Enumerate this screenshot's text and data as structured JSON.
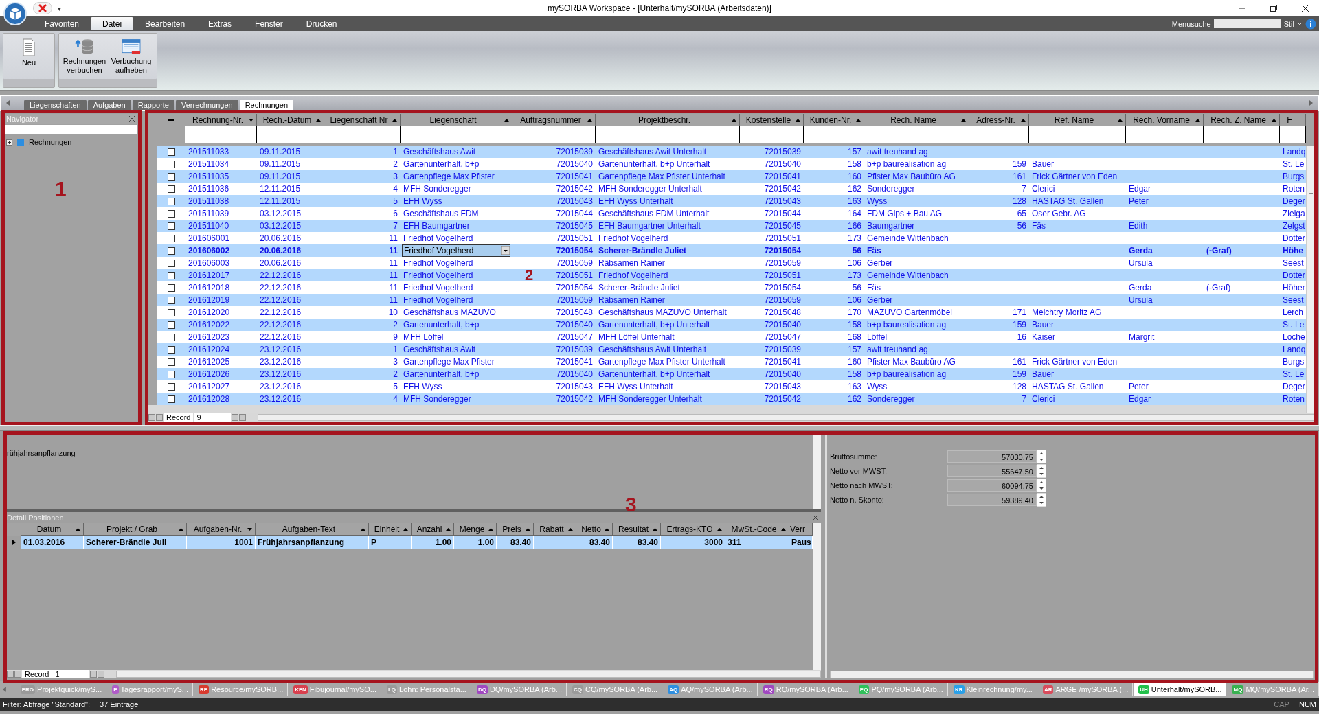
{
  "window": {
    "title": "mySORBA Workspace - [Unterhalt/mySORBA (Arbeitsdaten)]",
    "quick_access": "▾"
  },
  "menu_tabs": [
    {
      "label": "Favoriten",
      "selected": false
    },
    {
      "label": "Datei",
      "selected": true
    },
    {
      "label": "Bearbeiten",
      "selected": false
    },
    {
      "label": "Extras",
      "selected": false
    },
    {
      "label": "Fenster",
      "selected": false
    },
    {
      "label": "Drucken",
      "selected": false
    }
  ],
  "menu_search": {
    "label": "Menusuche",
    "style_label": "Stil"
  },
  "ribbon": [
    {
      "kind": "new",
      "label": "Neu"
    },
    {
      "kind": "post",
      "label": "Rechnungen verbuchen"
    },
    {
      "kind": "unpost",
      "label": "Verbuchung aufheben"
    }
  ],
  "doc_tabs": [
    {
      "label": "Liegenschaften",
      "selected": false
    },
    {
      "label": "Aufgaben",
      "selected": false
    },
    {
      "label": "Rapporte",
      "selected": false
    },
    {
      "label": "Verrechnungen",
      "selected": false
    },
    {
      "label": "Rechnungen",
      "selected": true
    }
  ],
  "navigator": {
    "title": "Navigator",
    "items": [
      {
        "label": "Rechnungen",
        "expanded": false
      }
    ]
  },
  "table": {
    "columns": [
      {
        "label": "Rechnung-Nr.",
        "descending": true
      },
      {
        "label": "Rech.-Datum",
        "descending": false
      },
      {
        "label": "Liegenschaft Nr",
        "descending": false
      },
      {
        "label": "Liegenschaft",
        "descending": false
      },
      {
        "label": "Auftragsnummer",
        "descending": false
      },
      {
        "label": "Projektbeschr.",
        "descending": false
      },
      {
        "label": "Kostenstelle",
        "descending": false
      },
      {
        "label": "Kunden-Nr.",
        "descending": false
      },
      {
        "label": "Rech. Name",
        "descending": false
      },
      {
        "label": "Adress-Nr.",
        "descending": false
      },
      {
        "label": "Ref. Name",
        "descending": false
      },
      {
        "label": "Rech. Vorname",
        "descending": false
      },
      {
        "label": "Rech. Z. Name",
        "descending": false
      },
      {
        "label": "F"
      }
    ],
    "rows": [
      {
        "selected": false,
        "checked": false,
        "cells": [
          "201511033",
          "09.11.2015",
          "1",
          "Geschäftshaus Awit",
          "72015039",
          "Geschäftshaus Awit Unterhalt",
          "72015039",
          "157",
          "awit treuhand ag",
          "",
          "",
          "",
          "",
          "Landq"
        ]
      },
      {
        "selected": false,
        "checked": false,
        "cells": [
          "201511034",
          "09.11.2015",
          "2",
          "Gartenunterhalt, b+p",
          "72015040",
          "Gartenunterhalt, b+p Unterhalt",
          "72015040",
          "158",
          "b+p baurealisation ag",
          "159",
          "Bauer",
          "",
          "",
          "St. Le"
        ]
      },
      {
        "selected": false,
        "checked": false,
        "cells": [
          "201511035",
          "09.11.2015",
          "3",
          "Gartenpflege Max Pfister",
          "72015041",
          "Gartenpflege Max Pfister Unterhalt",
          "72015041",
          "160",
          "Pfister Max Baubüro AG",
          "161",
          "Frick Gärtner von Eden",
          "",
          "",
          "Burgs"
        ]
      },
      {
        "selected": false,
        "checked": false,
        "cells": [
          "201511036",
          "12.11.2015",
          "4",
          "MFH Sonderegger",
          "72015042",
          "MFH Sonderegger Unterhalt",
          "72015042",
          "162",
          "Sonderegger",
          "7",
          "Clerici",
          "Edgar",
          "",
          "Roten"
        ]
      },
      {
        "selected": false,
        "checked": false,
        "cells": [
          "201511038",
          "12.11.2015",
          "5",
          "EFH Wyss",
          "72015043",
          "EFH Wyss Unterhalt",
          "72015043",
          "163",
          "Wyss",
          "128",
          "HASTAG St. Gallen",
          "Peter",
          "",
          "Deger"
        ]
      },
      {
        "selected": false,
        "checked": false,
        "cells": [
          "201511039",
          "03.12.2015",
          "6",
          "Geschäftshaus FDM",
          "72015044",
          "Geschäftshaus FDM Unterhalt",
          "72015044",
          "164",
          "FDM Gips + Bau AG",
          "65",
          "Oser Gebr. AG",
          "",
          "",
          "Zielga"
        ]
      },
      {
        "selected": false,
        "checked": false,
        "cells": [
          "201511040",
          "03.12.2015",
          "7",
          "EFH Baumgartner",
          "72015045",
          "EFH Baumgartner Unterhalt",
          "72015045",
          "166",
          "Baumgartner",
          "56",
          "Fäs",
          "Edith",
          "",
          "Zelgst"
        ]
      },
      {
        "selected": false,
        "checked": false,
        "cells": [
          "201606001",
          "20.06.2016",
          "11",
          "Friedhof Vogelherd",
          "72015051",
          "Friedhof Vogelherd",
          "72015051",
          "173",
          "Gemeinde Wittenbach",
          "",
          "",
          "",
          "",
          "Dotter"
        ]
      },
      {
        "selected": true,
        "checked": false,
        "cells": [
          "201606002",
          "20.06.2016",
          "11",
          "Friedhof Vogelherd",
          "72015054",
          "Scherer-Brändle Juliet",
          "72015054",
          "56",
          "Fäs",
          "",
          "",
          "Gerda",
          "(-Graf)",
          "Höhe"
        ]
      },
      {
        "selected": false,
        "checked": false,
        "cells": [
          "201606003",
          "20.06.2016",
          "11",
          "Friedhof Vogelherd",
          "72015059",
          "Räbsamen Rainer",
          "72015059",
          "106",
          "Gerber",
          "",
          "",
          "Ursula",
          "",
          "Seest"
        ]
      },
      {
        "selected": false,
        "checked": false,
        "cells": [
          "201612017",
          "22.12.2016",
          "11",
          "Friedhof Vogelherd",
          "72015051",
          "Friedhof Vogelherd",
          "72015051",
          "173",
          "Gemeinde Wittenbach",
          "",
          "",
          "",
          "",
          "Dotter"
        ]
      },
      {
        "selected": false,
        "checked": false,
        "cells": [
          "201612018",
          "22.12.2016",
          "11",
          "Friedhof Vogelherd",
          "72015054",
          "Scherer-Brändle Juliet",
          "72015054",
          "56",
          "Fäs",
          "",
          "",
          "Gerda",
          "(-Graf)",
          "Höher"
        ]
      },
      {
        "selected": false,
        "checked": false,
        "cells": [
          "201612019",
          "22.12.2016",
          "11",
          "Friedhof Vogelherd",
          "72015059",
          "Räbsamen Rainer",
          "72015059",
          "106",
          "Gerber",
          "",
          "",
          "Ursula",
          "",
          "Seest"
        ]
      },
      {
        "selected": false,
        "checked": false,
        "cells": [
          "201612020",
          "22.12.2016",
          "10",
          "Geschäftshaus MAZUVO",
          "72015048",
          "Geschäftshaus MAZUVO Unterhalt",
          "72015048",
          "170",
          "MAZUVO Gartenmöbel",
          "171",
          "Meichtry Moritz AG",
          "",
          "",
          "Lerch"
        ]
      },
      {
        "selected": false,
        "checked": false,
        "cells": [
          "201612022",
          "22.12.2016",
          "2",
          "Gartenunterhalt, b+p",
          "72015040",
          "Gartenunterhalt, b+p Unterhalt",
          "72015040",
          "158",
          "b+p baurealisation ag",
          "159",
          "Bauer",
          "",
          "",
          "St. Le"
        ]
      },
      {
        "selected": false,
        "checked": false,
        "cells": [
          "201612023",
          "22.12.2016",
          "9",
          "MFH Löffel",
          "72015047",
          "MFH Löffel Unterhalt",
          "72015047",
          "168",
          "Löffel",
          "16",
          "Kaiser",
          "Margrit",
          "",
          "Loche"
        ]
      },
      {
        "selected": false,
        "checked": false,
        "cells": [
          "201612024",
          "23.12.2016",
          "1",
          "Geschäftshaus Awit",
          "72015039",
          "Geschäftshaus Awit Unterhalt",
          "72015039",
          "157",
          "awit treuhand ag",
          "",
          "",
          "",
          "",
          "Landq"
        ]
      },
      {
        "selected": false,
        "checked": false,
        "cells": [
          "201612025",
          "23.12.2016",
          "3",
          "Gartenpflege Max Pfister",
          "72015041",
          "Gartenpflege Max Pfister Unterhalt",
          "72015041",
          "160",
          "Pfister Max Baubüro AG",
          "161",
          "Frick Gärtner von Eden",
          "",
          "",
          "Burgs"
        ]
      },
      {
        "selected": false,
        "checked": false,
        "cells": [
          "201612026",
          "23.12.2016",
          "2",
          "Gartenunterhalt, b+p",
          "72015040",
          "Gartenunterhalt, b+p Unterhalt",
          "72015040",
          "158",
          "b+p baurealisation ag",
          "159",
          "Bauer",
          "",
          "",
          "St. Le"
        ]
      },
      {
        "selected": false,
        "checked": false,
        "cells": [
          "201612027",
          "23.12.2016",
          "5",
          "EFH Wyss",
          "72015043",
          "EFH Wyss Unterhalt",
          "72015043",
          "163",
          "Wyss",
          "128",
          "HASTAG St. Gallen",
          "Peter",
          "",
          "Deger"
        ]
      },
      {
        "selected": false,
        "checked": false,
        "cells": [
          "201612028",
          "23.12.2016",
          "4",
          "MFH Sonderegger",
          "72015042",
          "MFH Sonderegger Unterhalt",
          "72015042",
          "162",
          "Sonderegger",
          "7",
          "Clerici",
          "Edgar",
          "",
          "Roten"
        ]
      }
    ],
    "record_label": "Record",
    "record_value": "9"
  },
  "invoice_text": "rühjahrsanpflanzung",
  "detail": {
    "title": "Detail Positionen",
    "columns": [
      {
        "label": "Datum",
        "descending": false
      },
      {
        "label": "Projekt / Grab",
        "descending": false
      },
      {
        "label": "Aufgaben-Nr.",
        "descending": true
      },
      {
        "label": "Aufgaben-Text",
        "descending": false
      },
      {
        "label": "Einheit",
        "descending": false
      },
      {
        "label": "Anzahl",
        "descending": false
      },
      {
        "label": "Menge",
        "descending": false
      },
      {
        "label": "Preis",
        "descending": false
      },
      {
        "label": "Rabatt",
        "descending": false
      },
      {
        "label": "Netto",
        "descending": false
      },
      {
        "label": "Resultat",
        "descending": false
      },
      {
        "label": "Ertrags-KTO",
        "descending": false
      },
      {
        "label": "MwSt.-Code",
        "descending": false
      },
      {
        "label": "Verr"
      }
    ],
    "rows": [
      {
        "selected": true,
        "cells": [
          "01.03.2016",
          "Scherer-Brändle Juli",
          "1001",
          "Frühjahrsanpflanzung",
          "P",
          "1.00",
          "1.00",
          "83.40",
          "",
          "83.40",
          "83.40",
          "3000",
          "311",
          "Paus"
        ]
      }
    ],
    "record_label": "Record",
    "record_value": "1"
  },
  "totals": [
    {
      "label": "Bruttosumme:",
      "value": "57030.75"
    },
    {
      "label": "Netto vor MWST:",
      "value": "55647.50"
    },
    {
      "label": "Netto nach MWST:",
      "value": "60094.75"
    },
    {
      "label": "Netto n. Skonto:",
      "value": "59389.40"
    }
  ],
  "taskbar": [
    {
      "badge": "PRO",
      "label": "Projektquick/myS...",
      "color": "#9a9a9a",
      "selected": false
    },
    {
      "badge": "E",
      "label": "Tagesrapport/myS...",
      "color": "#b05cc8",
      "selected": false
    },
    {
      "badge": "RP",
      "label": "Resource/mySORB...",
      "color": "#d83a2e",
      "selected": false
    },
    {
      "badge": "KFN",
      "label": "Fibujournal/mySO...",
      "color": "#d8404e",
      "selected": false
    },
    {
      "badge": "LQ",
      "label": "Lohn: Personalsta...",
      "color": "#9a9a9a",
      "selected": false
    },
    {
      "badge": "DQ",
      "label": "DQ/mySORBA (Arb...",
      "color": "#a048c0",
      "selected": false
    },
    {
      "badge": "CQ",
      "label": "CQ/mySORBA (Arb...",
      "color": "#9a9a9a",
      "selected": false
    },
    {
      "badge": "AQ",
      "label": "AQ/mySORBA (Arb...",
      "color": "#2f8fe0",
      "selected": false
    },
    {
      "badge": "RQ",
      "label": "RQ/mySORBA (Arb...",
      "color": "#a048c0",
      "selected": false
    },
    {
      "badge": "PQ",
      "label": "PQ/mySORBA (Arb...",
      "color": "#2fc05a",
      "selected": false
    },
    {
      "badge": "KR",
      "label": "Kleinrechnung/my...",
      "color": "#2aa0e8",
      "selected": false
    },
    {
      "badge": "AR",
      "label": "ARGE /mySORBA (...",
      "color": "#d84c5c",
      "selected": false
    },
    {
      "badge": "UH",
      "label": "Unterhalt/mySORB...",
      "color": "#22c04a",
      "selected": true
    },
    {
      "badge": "MQ",
      "label": "MQ/mySORBA (Ar...",
      "color": "#38b050",
      "selected": false
    }
  ],
  "status_bar": {
    "filter": "Filter: Abfrage \"Standard\":",
    "count": "37 Einträge",
    "indicators": [
      {
        "label": "CAP",
        "on": false
      },
      {
        "label": "NUM",
        "on": true
      }
    ]
  },
  "annotations": [
    {
      "label": "1"
    },
    {
      "label": "2"
    },
    {
      "label": "3"
    }
  ]
}
